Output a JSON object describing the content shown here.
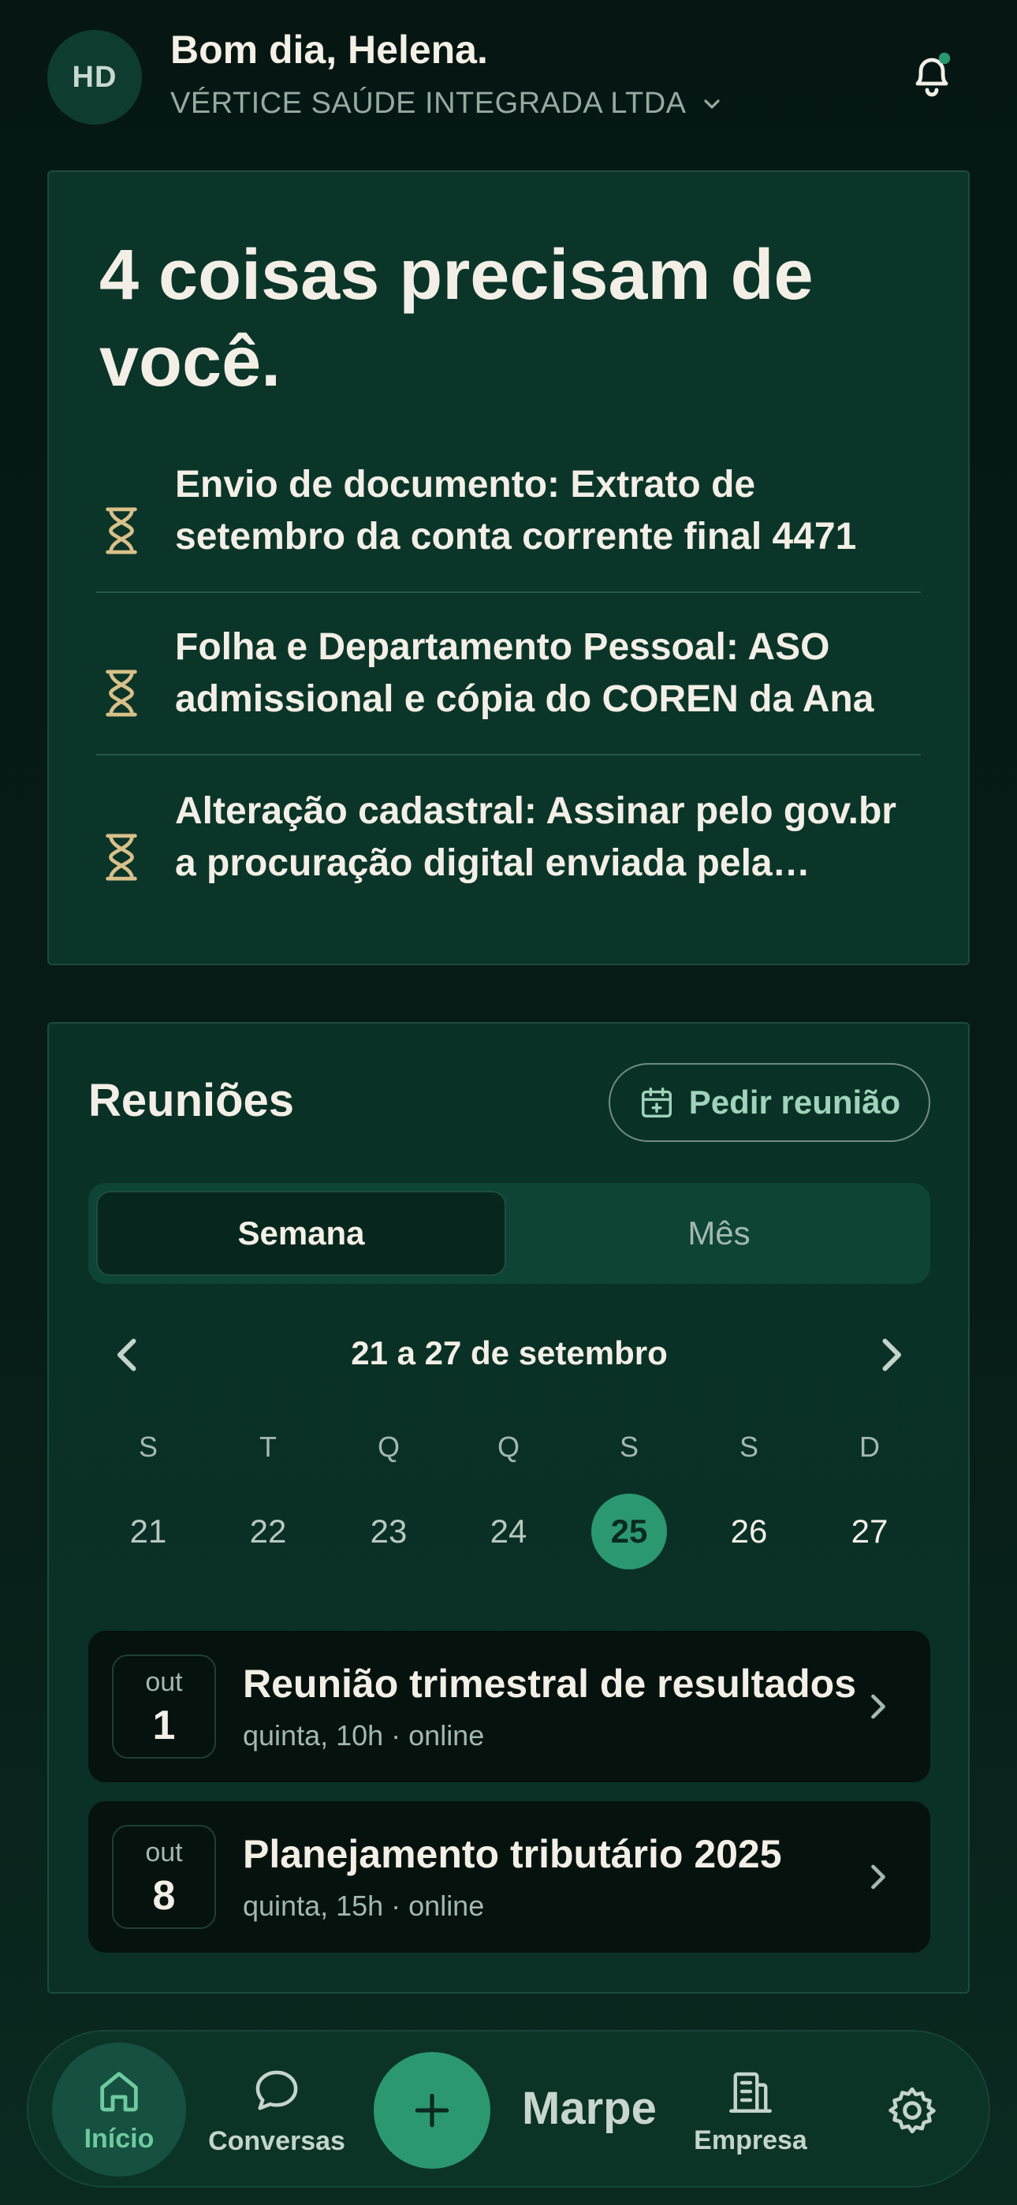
{
  "header": {
    "avatar_initials": "HD",
    "greeting": "Bom dia, Helena.",
    "company": "VÉRTICE SAÚDE INTEGRADA LTDA",
    "notification_dot_color": "#2b9872"
  },
  "pending": {
    "title": "4 coisas precisam de você.",
    "tasks": [
      {
        "text": "Envio de documento: Extrato de setembro da conta corrente final 4471"
      },
      {
        "text": "Folha e Departamento Pessoal: ASO admissional e cópia do COREN da Ana"
      },
      {
        "text": "Alteração cadastral: Assinar pelo gov.br a procuração digital enviada pela contabilidade"
      }
    ]
  },
  "meetings": {
    "title": "Reuniões",
    "request_button": "Pedir reunião",
    "segment": {
      "week": "Semana",
      "month": "Mês"
    },
    "week_label": "21 a 27 de setembro",
    "weekdays": [
      "S",
      "T",
      "Q",
      "Q",
      "S",
      "S",
      "D"
    ],
    "days": [
      "21",
      "22",
      "23",
      "24",
      "25",
      "26",
      "27"
    ],
    "today": "25",
    "items": [
      {
        "month": "out",
        "day": "1",
        "title": "Reunião trimestral de resultados",
        "subtitle": "quinta, 10h · online"
      },
      {
        "month": "out",
        "day": "8",
        "title": "Planejamento tributário 2025",
        "subtitle": "quinta, 15h · online"
      }
    ]
  },
  "nav": {
    "home": "Início",
    "conversations": "Conversas",
    "brand": "Marpe",
    "company": "Empresa"
  },
  "colors": {
    "accent": "#2b9872",
    "hourglass": "#d9c08a"
  }
}
